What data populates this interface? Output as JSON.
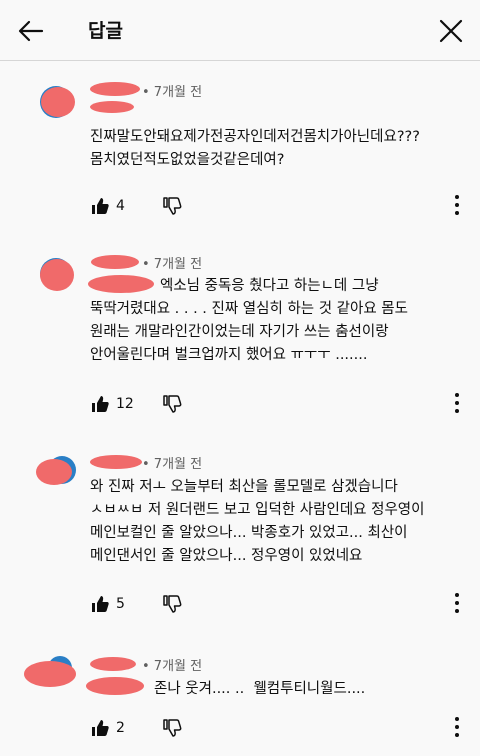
{
  "header": {
    "title": "답글"
  },
  "comments": [
    {
      "time": "• 7개월 전",
      "lines": [
        "진짜말도안돼요제가전공자인데저건몸치가아닌데요???",
        "몸치였던적도없었을것같은데여?"
      ],
      "likes": "4"
    },
    {
      "time": "• 7개월 전",
      "lines": [
        "엑소님 중독응 췄다고 하는ㄴ데 그냥",
        "뚝딱거렸대요 . . . . 진짜 열심히 하는 것 같아요 몸도",
        "원래는 개말라인간이었는데 자기가 쓰는 춤선이랑",
        "안어울린다며 벌크업까지 했어요 ㅠㅜㅜ ......."
      ],
      "likes": "12"
    },
    {
      "time": "• 7개월 전",
      "lines": [
        "와 진짜 저ㅗ 오늘부터 최산을 롤모델로 삼겠습니다",
        "ㅅㅂㅆㅂ 저 원더랜드 보고 입덕한 사람인데요 정우영이",
        "메인보컬인 줄 알았으나... 박종호가 있었고... 최산이",
        "메인댄서인 줄 알았으나... 정우영이 있었네요"
      ],
      "likes": "5"
    },
    {
      "time": "• 7개월 전",
      "lines": [
        "존나 웃겨.... ..  웰컴투티니월드...."
      ],
      "likes": "2"
    }
  ]
}
